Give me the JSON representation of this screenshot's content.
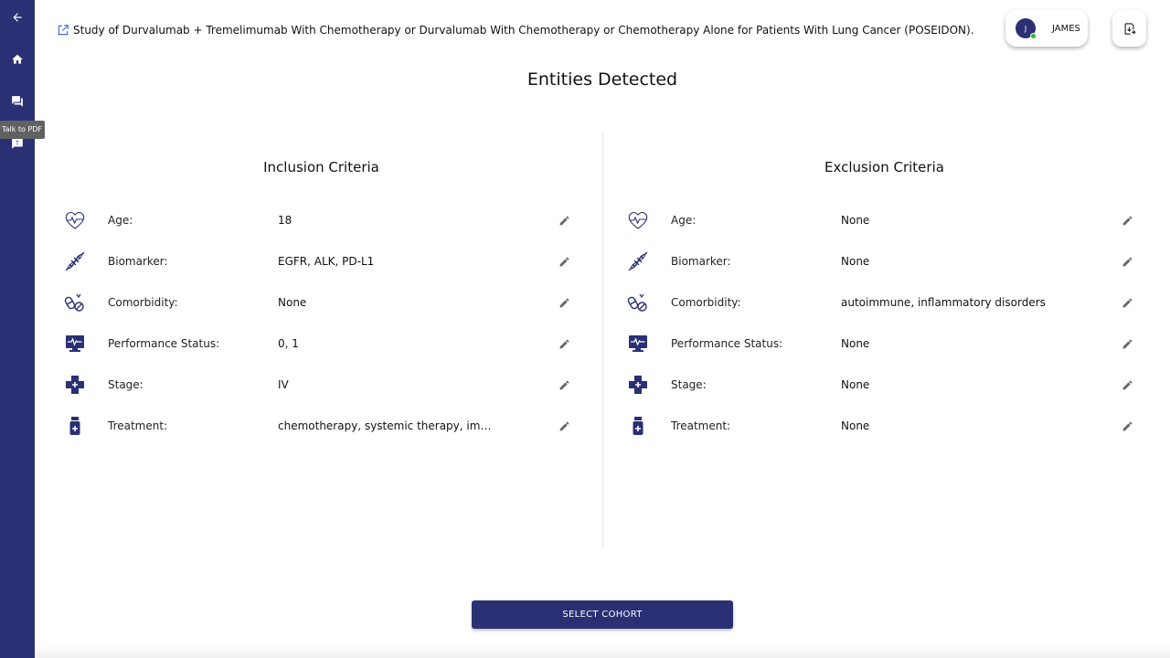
{
  "sidebar": {
    "tooltip": "Talk to PDF",
    "items": [
      {
        "name": "back-arrow-icon"
      },
      {
        "name": "home-icon"
      },
      {
        "name": "chat-icon"
      },
      {
        "name": "feedback-icon"
      }
    ]
  },
  "header": {
    "study_title": "Study of Durvalumab + Tremelimumab With Chemotherapy or Durvalumab With Chemotherapy or Chemotherapy Alone for Patients With Lung Cancer (POSEIDON).",
    "user_initial": "J",
    "user_name": "JAMES"
  },
  "page_title": "Entities Detected",
  "inclusion": {
    "title": "Inclusion Criteria",
    "rows": [
      {
        "icon": "heart-pulse-icon",
        "label": "Age:",
        "value": "18"
      },
      {
        "icon": "dna-icon",
        "label": "Biomarker:",
        "value": "EGFR, ALK, PD-L1"
      },
      {
        "icon": "pills-icon",
        "label": "Comorbidity:",
        "value": "None"
      },
      {
        "icon": "monitor-icon",
        "label": "Performance Status:",
        "value": "0, 1"
      },
      {
        "icon": "medical-cross-icon",
        "label": "Stage:",
        "value": "IV"
      },
      {
        "icon": "medicine-bottle-icon",
        "label": "Treatment:",
        "value": "chemotherapy, systemic therapy, imm..."
      }
    ]
  },
  "exclusion": {
    "title": "Exclusion Criteria",
    "rows": [
      {
        "icon": "heart-pulse-icon",
        "label": "Age:",
        "value": "None"
      },
      {
        "icon": "dna-icon",
        "label": "Biomarker:",
        "value": "None"
      },
      {
        "icon": "pills-icon",
        "label": "Comorbidity:",
        "value": "autoimmune, inflammatory disorders"
      },
      {
        "icon": "monitor-icon",
        "label": "Performance Status:",
        "value": "None"
      },
      {
        "icon": "medical-cross-icon",
        "label": "Stage:",
        "value": "None"
      },
      {
        "icon": "medicine-bottle-icon",
        "label": "Treatment:",
        "value": "None"
      }
    ]
  },
  "footer": {
    "select_cohort_label": "SELECT COHORT"
  },
  "colors": {
    "primary": "#2a3073",
    "link": "#2f5fd0",
    "status_online": "#2eb82e"
  }
}
